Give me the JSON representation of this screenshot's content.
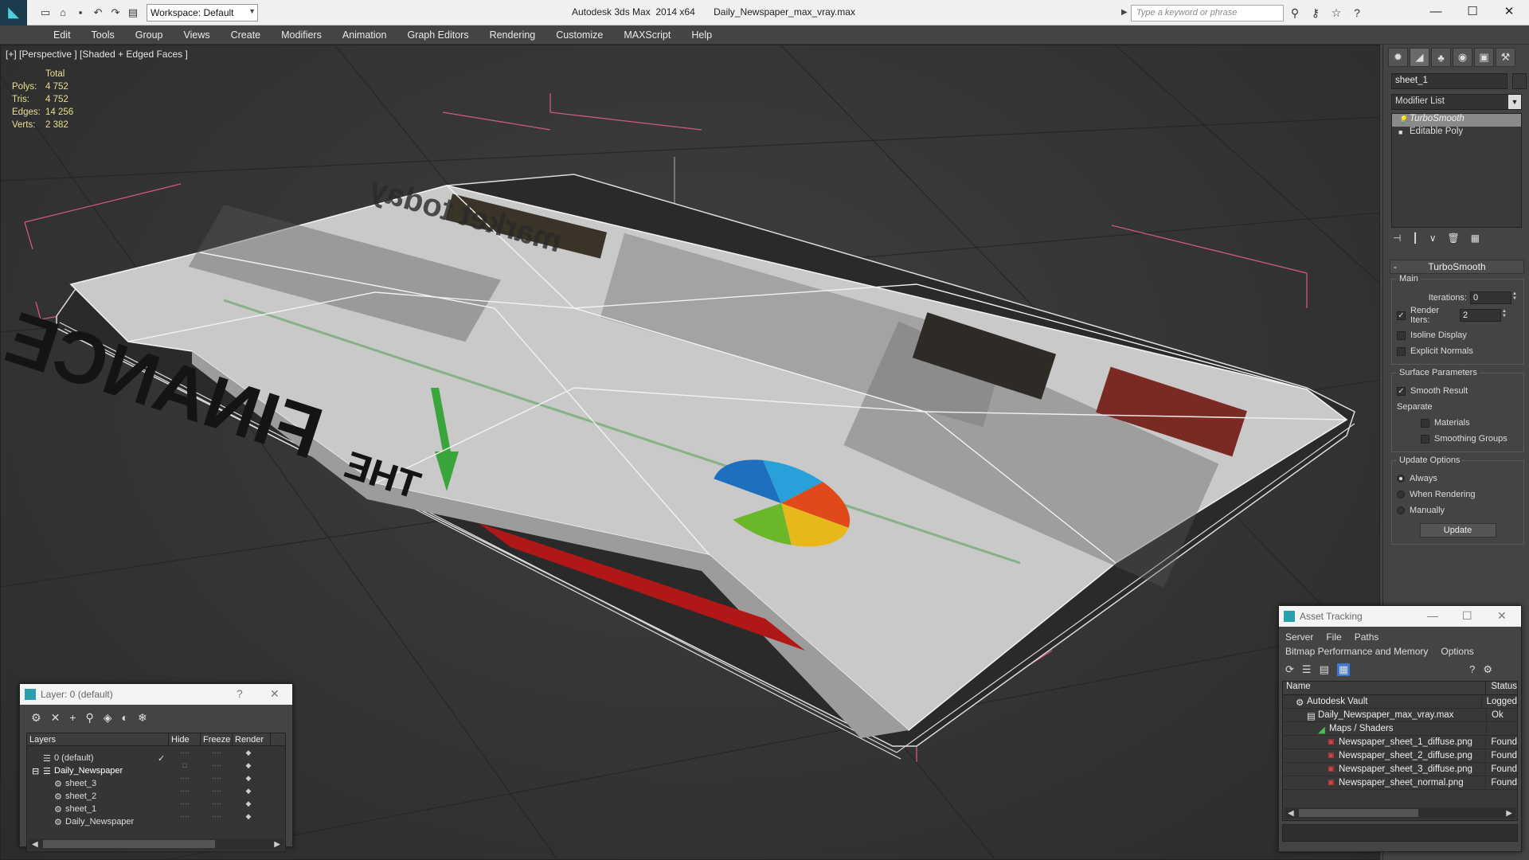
{
  "window": {
    "title_app": "Autodesk 3ds Max  2014 x64",
    "title_file": "Daily_Newspaper_max_vray.max",
    "workspace": "Workspace: Default",
    "search_placeholder": "Type a keyword or phrase"
  },
  "menu": [
    "Edit",
    "Tools",
    "Group",
    "Views",
    "Create",
    "Modifiers",
    "Animation",
    "Graph Editors",
    "Rendering",
    "Customize",
    "MAXScript",
    "Help"
  ],
  "viewport": {
    "label": "[+] [Perspective ] [Shaded + Edged Faces ]",
    "stats": {
      "header": "Total",
      "polys_label": "Polys:",
      "polys": "4 752",
      "tris_label": "Tris:",
      "tris": "4 752",
      "edges_label": "Edges:",
      "edges": "14 256",
      "verts_label": "Verts:",
      "verts": "2 382"
    },
    "newspaper_text": {
      "finance": "FINANCE",
      "the": "THE",
      "headline": "market today"
    }
  },
  "command_panel": {
    "object_name": "sheet_1",
    "modifier_list": "Modifier List",
    "stack": [
      "TurboSmooth",
      "Editable Poly"
    ],
    "rollout_title": "TurboSmooth",
    "main_group": "Main",
    "iterations_label": "Iterations:",
    "iterations_value": "0",
    "render_iters_label": "Render Iters:",
    "render_iters_value": "2",
    "isoline": "Isoline Display",
    "explicit_normals": "Explicit Normals",
    "surface_group": "Surface Parameters",
    "smooth_result": "Smooth Result",
    "separate": "Separate",
    "materials": "Materials",
    "smoothing_groups": "Smoothing Groups",
    "update_group": "Update Options",
    "always": "Always",
    "when_rendering": "When Rendering",
    "manually": "Manually",
    "update_btn": "Update"
  },
  "layer_window": {
    "title": "Layer: 0 (default)",
    "help": "?",
    "col_layers": "Layers",
    "col_hide": "Hide",
    "col_freeze": "Freeze",
    "col_render": "Render",
    "rows": [
      {
        "name": "0 (default)"
      },
      {
        "name": "Daily_Newspaper"
      },
      {
        "name": "sheet_3"
      },
      {
        "name": "sheet_2"
      },
      {
        "name": "sheet_1"
      },
      {
        "name": "Daily_Newspaper"
      }
    ]
  },
  "asset_tracking": {
    "title": "Asset Tracking",
    "menu": [
      "Server",
      "File",
      "Paths"
    ],
    "menu2": [
      "Bitmap Performance and Memory",
      "Options"
    ],
    "col_name": "Name",
    "col_status": "Status",
    "rows": [
      {
        "name": "Autodesk Vault",
        "status": "Logged"
      },
      {
        "name": "Daily_Newspaper_max_vray.max",
        "status": "Ok"
      },
      {
        "name": "Maps / Shaders",
        "status": ""
      },
      {
        "name": "Newspaper_sheet_1_diffuse.png",
        "status": "Found"
      },
      {
        "name": "Newspaper_sheet_2_diffuse.png",
        "status": "Found"
      },
      {
        "name": "Newspaper_sheet_3_diffuse.png",
        "status": "Found"
      },
      {
        "name": "Newspaper_sheet_normal.png",
        "status": "Found"
      }
    ]
  }
}
